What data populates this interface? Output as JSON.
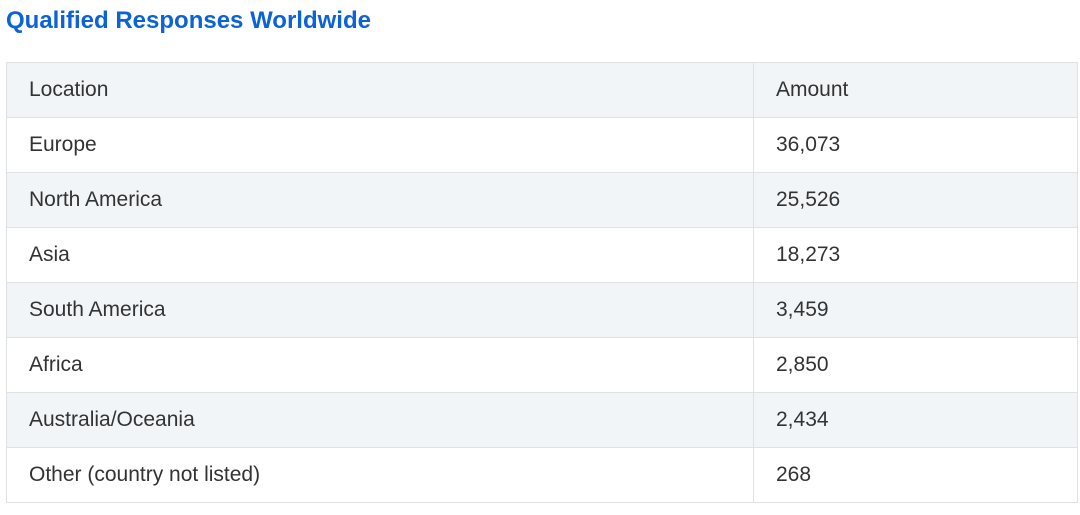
{
  "title": "Qualified Responses Worldwide",
  "colors": {
    "title": "#0b63d6",
    "text": "#333333",
    "border": "#dfe2e5",
    "header_bg": "#f2f5f8",
    "stripe_bg": "#f2f5f8"
  },
  "chart_data": {
    "type": "table",
    "title": "Qualified Responses Worldwide",
    "columns": [
      "Location",
      "Amount"
    ],
    "rows": [
      [
        "Europe",
        "36,073"
      ],
      [
        "North America",
        "25,526"
      ],
      [
        "Asia",
        "18,273"
      ],
      [
        "South America",
        "3,459"
      ],
      [
        "Africa",
        "2,850"
      ],
      [
        "Australia/Oceania",
        "2,434"
      ],
      [
        "Other (country not listed)",
        "268"
      ]
    ]
  }
}
